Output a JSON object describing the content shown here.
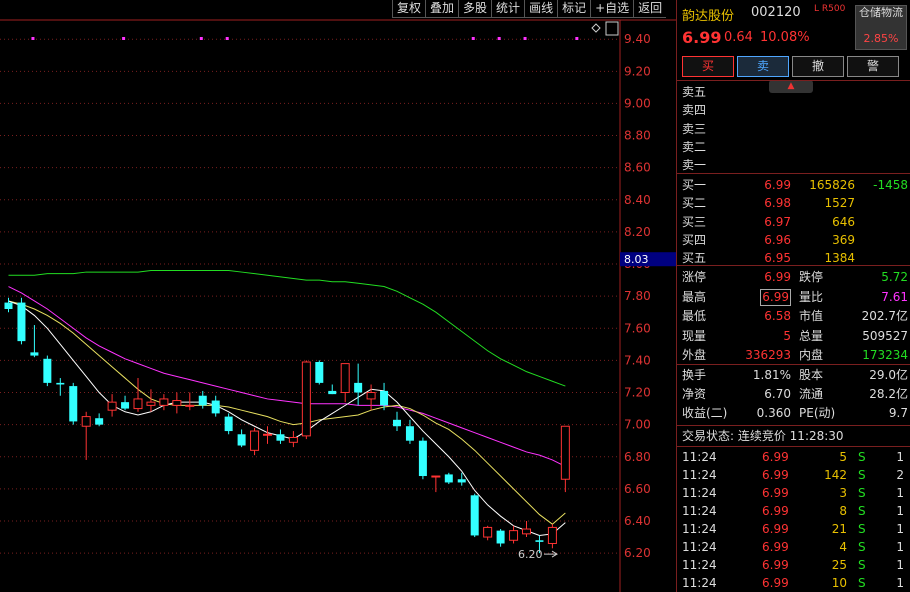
{
  "toolbar": {
    "items": [
      "复权",
      "叠加",
      "多股",
      "统计",
      "画线",
      "标记",
      "+自选",
      "返回"
    ]
  },
  "chart": {
    "price_ticks": [
      "9.40",
      "9.20",
      "9.00",
      "8.80",
      "8.60",
      "8.40",
      "8.20",
      "8.00",
      "7.80",
      "7.60",
      "7.40",
      "7.20",
      "7.00",
      "6.80",
      "6.60",
      "6.40",
      "6.20"
    ],
    "current_label": "8.03",
    "low_label": "6.20",
    "colors": {
      "up": "#ff3333",
      "down": "#33ffff",
      "ma5": "#ffffff",
      "ma10": "#e8e060",
      "ma20": "#ff33ff",
      "ma60": "#22dd22",
      "grid": "#7a1f1f",
      "hline": "#000080"
    }
  },
  "chart_data": {
    "type": "candlestick",
    "ylim": [
      6.14,
      9.56
    ],
    "candles": [
      {
        "o": 7.76,
        "h": 7.79,
        "l": 7.7,
        "c": 7.72
      },
      {
        "o": 7.76,
        "h": 7.79,
        "l": 7.5,
        "c": 7.52
      },
      {
        "o": 7.45,
        "h": 7.62,
        "l": 7.42,
        "c": 7.43
      },
      {
        "o": 7.41,
        "h": 7.43,
        "l": 7.24,
        "c": 7.26
      },
      {
        "o": 7.26,
        "h": 7.29,
        "l": 7.18,
        "c": 7.25
      },
      {
        "o": 7.24,
        "h": 7.26,
        "l": 7.0,
        "c": 7.02
      },
      {
        "o": 6.99,
        "h": 7.08,
        "l": 6.78,
        "c": 7.05
      },
      {
        "o": 7.04,
        "h": 7.07,
        "l": 6.99,
        "c": 7.0
      },
      {
        "o": 7.09,
        "h": 7.19,
        "l": 7.05,
        "c": 7.14
      },
      {
        "o": 7.14,
        "h": 7.18,
        "l": 7.09,
        "c": 7.1
      },
      {
        "o": 7.1,
        "h": 7.29,
        "l": 7.08,
        "c": 7.16
      },
      {
        "o": 7.12,
        "h": 7.22,
        "l": 7.08,
        "c": 7.14
      },
      {
        "o": 7.12,
        "h": 7.19,
        "l": 7.09,
        "c": 7.16
      },
      {
        "o": 7.12,
        "h": 7.2,
        "l": 7.07,
        "c": 7.15
      },
      {
        "o": 7.12,
        "h": 7.2,
        "l": 7.09,
        "c": 7.12
      },
      {
        "o": 7.18,
        "h": 7.21,
        "l": 7.1,
        "c": 7.12
      },
      {
        "o": 7.15,
        "h": 7.18,
        "l": 7.05,
        "c": 7.07
      },
      {
        "o": 7.05,
        "h": 7.07,
        "l": 6.94,
        "c": 6.96
      },
      {
        "o": 6.94,
        "h": 6.97,
        "l": 6.86,
        "c": 6.87
      },
      {
        "o": 6.84,
        "h": 6.98,
        "l": 6.81,
        "c": 6.96
      },
      {
        "o": 6.94,
        "h": 6.99,
        "l": 6.88,
        "c": 6.94
      },
      {
        "o": 6.94,
        "h": 6.97,
        "l": 6.88,
        "c": 6.9
      },
      {
        "o": 6.89,
        "h": 6.96,
        "l": 6.86,
        "c": 6.92
      },
      {
        "o": 6.93,
        "h": 7.4,
        "l": 6.91,
        "c": 7.39
      },
      {
        "o": 7.39,
        "h": 7.4,
        "l": 7.25,
        "c": 7.26
      },
      {
        "o": 7.21,
        "h": 7.25,
        "l": 7.19,
        "c": 7.19
      },
      {
        "o": 7.2,
        "h": 7.38,
        "l": 7.14,
        "c": 7.38
      },
      {
        "o": 7.26,
        "h": 7.38,
        "l": 7.12,
        "c": 7.2
      },
      {
        "o": 7.16,
        "h": 7.25,
        "l": 7.09,
        "c": 7.2
      },
      {
        "o": 7.21,
        "h": 7.26,
        "l": 7.09,
        "c": 7.12
      },
      {
        "o": 7.03,
        "h": 7.08,
        "l": 6.96,
        "c": 6.99
      },
      {
        "o": 6.99,
        "h": 7.03,
        "l": 6.88,
        "c": 6.9
      },
      {
        "o": 6.9,
        "h": 6.92,
        "l": 6.66,
        "c": 6.68
      },
      {
        "o": 6.68,
        "h": 6.68,
        "l": 6.58,
        "c": 6.68
      },
      {
        "o": 6.69,
        "h": 6.7,
        "l": 6.63,
        "c": 6.64
      },
      {
        "o": 6.66,
        "h": 6.7,
        "l": 6.62,
        "c": 6.64
      },
      {
        "o": 6.56,
        "h": 6.57,
        "l": 6.3,
        "c": 6.31
      },
      {
        "o": 6.3,
        "h": 6.37,
        "l": 6.28,
        "c": 6.36
      },
      {
        "o": 6.34,
        "h": 6.35,
        "l": 6.24,
        "c": 6.26
      },
      {
        "o": 6.28,
        "h": 6.37,
        "l": 6.26,
        "c": 6.34
      },
      {
        "o": 6.32,
        "h": 6.4,
        "l": 6.3,
        "c": 6.35
      },
      {
        "o": 6.28,
        "h": 6.31,
        "l": 6.2,
        "c": 6.27
      },
      {
        "o": 6.26,
        "h": 6.38,
        "l": 6.23,
        "c": 6.36
      },
      {
        "o": 6.66,
        "h": 6.99,
        "l": 6.58,
        "c": 6.99
      }
    ],
    "ma5": [
      7.77,
      7.74,
      7.68,
      7.6,
      7.5,
      7.4,
      7.3,
      7.2,
      7.12,
      7.08,
      7.06,
      7.08,
      7.12,
      7.14,
      7.14,
      7.14,
      7.12,
      7.08,
      7.03,
      6.99,
      6.95,
      6.93,
      6.91,
      6.96,
      7.02,
      7.07,
      7.12,
      7.17,
      7.22,
      7.21,
      7.14,
      7.05,
      6.96,
      6.88,
      6.8,
      6.71,
      6.59,
      6.5,
      6.43,
      6.37,
      6.34,
      6.31,
      6.32,
      6.39
    ],
    "ma10": [
      7.77,
      7.75,
      7.72,
      7.68,
      7.63,
      7.57,
      7.5,
      7.43,
      7.36,
      7.29,
      7.22,
      7.16,
      7.13,
      7.12,
      7.12,
      7.12,
      7.12,
      7.11,
      7.09,
      7.07,
      7.05,
      7.02,
      7.0,
      7.01,
      7.03,
      7.04,
      7.05,
      7.06,
      7.09,
      7.11,
      7.12,
      7.1,
      7.06,
      7.01,
      6.97,
      6.91,
      6.84,
      6.76,
      6.68,
      6.6,
      6.52,
      6.44,
      6.38,
      6.45
    ],
    "ma20": [
      7.86,
      7.82,
      7.77,
      7.72,
      7.66,
      7.6,
      7.54,
      7.49,
      7.45,
      7.41,
      7.38,
      7.35,
      7.32,
      7.3,
      7.28,
      7.26,
      7.24,
      7.22,
      7.2,
      7.18,
      7.16,
      7.15,
      7.14,
      7.13,
      7.13,
      7.13,
      7.13,
      7.12,
      7.12,
      7.12,
      7.11,
      7.09,
      7.07,
      7.04,
      7.01,
      6.98,
      6.95,
      6.92,
      6.89,
      6.86,
      6.83,
      6.81,
      6.78,
      6.74
    ],
    "ma60": [
      7.93,
      7.93,
      7.93,
      7.94,
      7.94,
      7.94,
      7.95,
      7.95,
      7.95,
      7.95,
      7.95,
      7.96,
      7.96,
      7.96,
      7.96,
      7.96,
      7.96,
      7.96,
      7.95,
      7.94,
      7.93,
      7.92,
      7.91,
      7.9,
      7.9,
      7.89,
      7.89,
      7.88,
      7.87,
      7.86,
      7.83,
      7.79,
      7.75,
      7.7,
      7.64,
      7.58,
      7.52,
      7.46,
      7.41,
      7.37,
      7.33,
      7.3,
      7.27,
      7.24
    ],
    "markers": [
      1,
      8,
      14,
      16,
      35,
      37,
      39,
      43
    ],
    "current_price_line": 8.03
  },
  "stock": {
    "name": "韵达股份",
    "code": "002120",
    "tag": "L R500",
    "sector": "仓储物流",
    "sector_pct": "2.85%",
    "price": "6.99",
    "change": "0.64",
    "change_pct": "10.08%"
  },
  "trade_buttons": [
    "买",
    "卖",
    "撤",
    "警"
  ],
  "expand_icon": "▲",
  "asks": [
    {
      "label": "卖五"
    },
    {
      "label": "卖四"
    },
    {
      "label": "卖三"
    },
    {
      "label": "卖二"
    },
    {
      "label": "卖一"
    }
  ],
  "bids": [
    {
      "label": "买一",
      "price": "6.99",
      "vol": "165826",
      "delta": "-1458"
    },
    {
      "label": "买二",
      "price": "6.98",
      "vol": "1527",
      "delta": ""
    },
    {
      "label": "买三",
      "price": "6.97",
      "vol": "646",
      "delta": ""
    },
    {
      "label": "买四",
      "price": "6.96",
      "vol": "369",
      "delta": ""
    },
    {
      "label": "买五",
      "price": "6.95",
      "vol": "1384",
      "delta": ""
    }
  ],
  "stats1": [
    {
      "l1": "涨停",
      "v1": "6.99",
      "c1": "red",
      "l2": "跌停",
      "v2": "5.72",
      "c2": "green"
    },
    {
      "l1": "最高",
      "v1": "6.99",
      "c1": "red",
      "l2": "量比",
      "v2": "7.61",
      "c2": "magenta"
    },
    {
      "l1": "最低",
      "v1": "6.58",
      "c1": "red",
      "l2": "市值",
      "v2": "202.7亿",
      "c2": "white"
    },
    {
      "l1": "现量",
      "v1": "5",
      "c1": "red",
      "l2": "总量",
      "v2": "509527",
      "c2": "white"
    },
    {
      "l1": "外盘",
      "v1": "336293",
      "c1": "red",
      "l2": "内盘",
      "v2": "173234",
      "c2": "green"
    }
  ],
  "stats2": [
    {
      "l1": "换手",
      "v1": "1.81%",
      "l2": "股本",
      "v2": "29.0亿"
    },
    {
      "l1": "净资",
      "v1": "6.70",
      "l2": "流通",
      "v2": "28.2亿"
    },
    {
      "l1": "收益(二)",
      "v1": "0.360",
      "l2": "PE(动)",
      "v2": "9.7"
    }
  ],
  "status": "交易状态: 连续竞价 11:28:30",
  "ticks": [
    {
      "t": "11:24",
      "p": "6.99",
      "v": "5",
      "s": "S",
      "n": "1"
    },
    {
      "t": "11:24",
      "p": "6.99",
      "v": "142",
      "s": "S",
      "n": "2"
    },
    {
      "t": "11:24",
      "p": "6.99",
      "v": "3",
      "s": "S",
      "n": "1"
    },
    {
      "t": "11:24",
      "p": "6.99",
      "v": "8",
      "s": "S",
      "n": "1"
    },
    {
      "t": "11:24",
      "p": "6.99",
      "v": "21",
      "s": "S",
      "n": "1"
    },
    {
      "t": "11:24",
      "p": "6.99",
      "v": "4",
      "s": "S",
      "n": "1"
    },
    {
      "t": "11:24",
      "p": "6.99",
      "v": "25",
      "s": "S",
      "n": "1"
    },
    {
      "t": "11:24",
      "p": "6.99",
      "v": "10",
      "s": "S",
      "n": "1"
    }
  ]
}
